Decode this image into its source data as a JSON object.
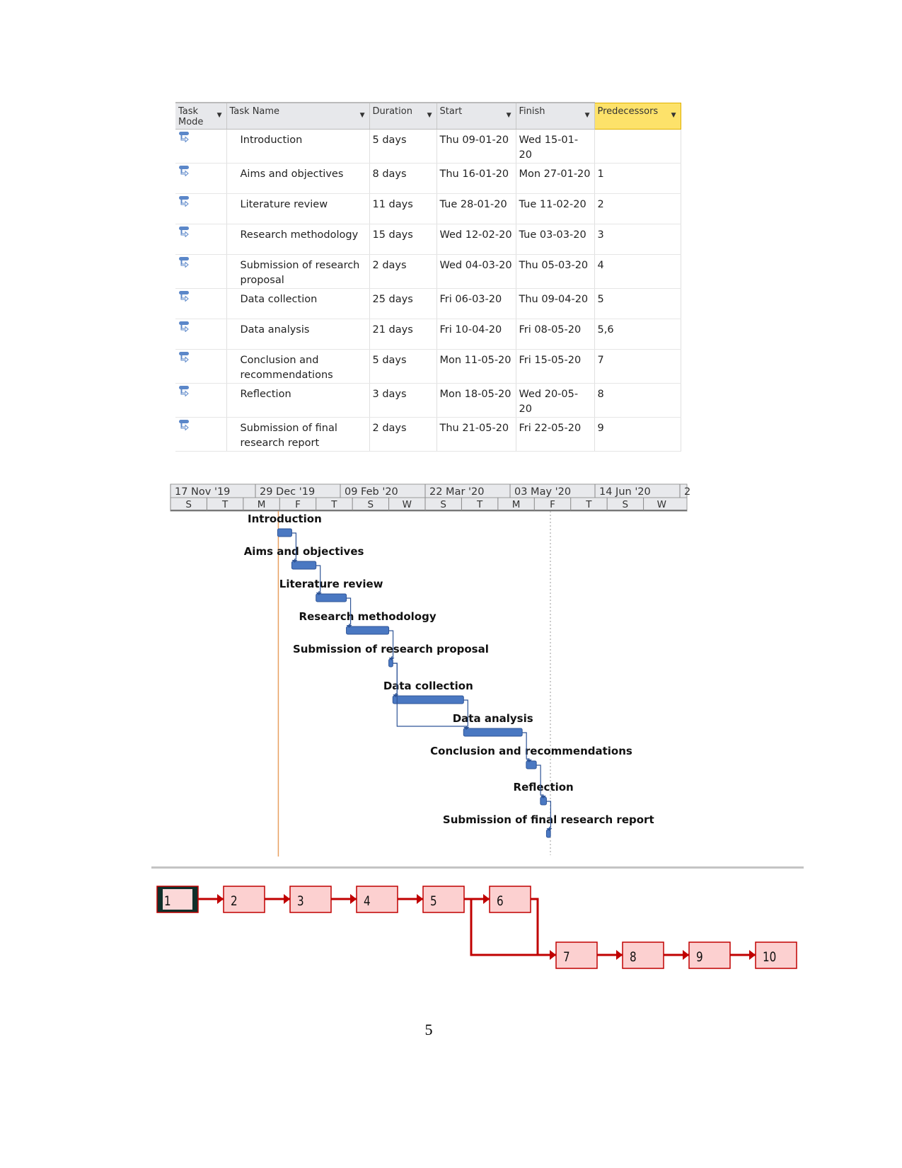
{
  "table": {
    "columns": [
      "Task Mode",
      "Task Name",
      "Duration",
      "Start",
      "Finish",
      "Predecessors"
    ],
    "task_mode_icon": "auto-scheduled-task-icon",
    "rows": [
      {
        "name": "Introduction",
        "duration": "5 days",
        "start": "Thu 09-01-20",
        "finish": "Wed 15-01-20",
        "pred": ""
      },
      {
        "name": "Aims and objectives",
        "duration": "8 days",
        "start": "Thu 16-01-20",
        "finish": "Mon 27-01-20",
        "pred": "1"
      },
      {
        "name": "Literature review",
        "duration": "11 days",
        "start": "Tue 28-01-20",
        "finish": "Tue 11-02-20",
        "pred": "2"
      },
      {
        "name": "Research methodology",
        "duration": "15 days",
        "start": "Wed 12-02-20",
        "finish": "Tue 03-03-20",
        "pred": "3"
      },
      {
        "name": "Submission of research proposal",
        "duration": "2 days",
        "start": "Wed 04-03-20",
        "finish": "Thu 05-03-20",
        "pred": "4"
      },
      {
        "name": "Data collection",
        "duration": "25 days",
        "start": "Fri 06-03-20",
        "finish": "Thu 09-04-20",
        "pred": "5"
      },
      {
        "name": "Data analysis",
        "duration": "21 days",
        "start": "Fri 10-04-20",
        "finish": "Fri 08-05-20",
        "pred": "5,6"
      },
      {
        "name": "Conclusion and recommendations",
        "duration": "5 days",
        "start": "Mon 11-05-20",
        "finish": "Fri 15-05-20",
        "pred": "7"
      },
      {
        "name": "Reflection",
        "duration": "3 days",
        "start": "Mon 18-05-20",
        "finish": "Wed 20-05-20",
        "pred": "8"
      },
      {
        "name": "Submission of final research report",
        "duration": "2 days",
        "start": "Thu 21-05-20",
        "finish": "Fri 22-05-20",
        "pred": "9"
      }
    ]
  },
  "gantt": {
    "major_ticks": [
      "17 Nov '19",
      "29 Dec '19",
      "09 Feb '20",
      "22 Mar '20",
      "03 May '20",
      "14 Jun '20",
      "2"
    ],
    "minor_ticks": [
      "S",
      "T",
      "M",
      "F",
      "T",
      "S",
      "W",
      "S",
      "T",
      "M",
      "F",
      "T",
      "S",
      "W"
    ],
    "bar_color": "#4a78c2",
    "project_start_line_color": "#e8a060",
    "tasks": [
      {
        "label": "Introduction",
        "start": "2020-01-09",
        "finish": "2020-01-15"
      },
      {
        "label": "Aims and objectives",
        "start": "2020-01-16",
        "finish": "2020-01-27"
      },
      {
        "label": "Literature review",
        "start": "2020-01-28",
        "finish": "2020-02-11"
      },
      {
        "label": "Research methodology",
        "start": "2020-02-12",
        "finish": "2020-03-03"
      },
      {
        "label": "Submission of research proposal",
        "start": "2020-03-04",
        "finish": "2020-03-05"
      },
      {
        "label": "Data collection",
        "start": "2020-03-06",
        "finish": "2020-04-09"
      },
      {
        "label": "Data analysis",
        "start": "2020-04-10",
        "finish": "2020-05-08"
      },
      {
        "label": "Conclusion and recommendations",
        "start": "2020-05-11",
        "finish": "2020-05-15"
      },
      {
        "label": "Reflection",
        "start": "2020-05-18",
        "finish": "2020-05-20"
      },
      {
        "label": "Submission of final research report",
        "start": "2020-05-21",
        "finish": "2020-05-22"
      }
    ]
  },
  "network": {
    "nodes": [
      "1",
      "2",
      "3",
      "4",
      "5",
      "6",
      "7",
      "8",
      "9",
      "10"
    ],
    "links": [
      [
        "1",
        "2"
      ],
      [
        "2",
        "3"
      ],
      [
        "3",
        "4"
      ],
      [
        "4",
        "5"
      ],
      [
        "5",
        "6"
      ],
      [
        "5",
        "7"
      ],
      [
        "6",
        "7"
      ],
      [
        "7",
        "8"
      ],
      [
        "8",
        "9"
      ],
      [
        "9",
        "10"
      ]
    ],
    "node_fill": "#fcd0d0",
    "link_color": "#c00000"
  },
  "page_number": "5"
}
